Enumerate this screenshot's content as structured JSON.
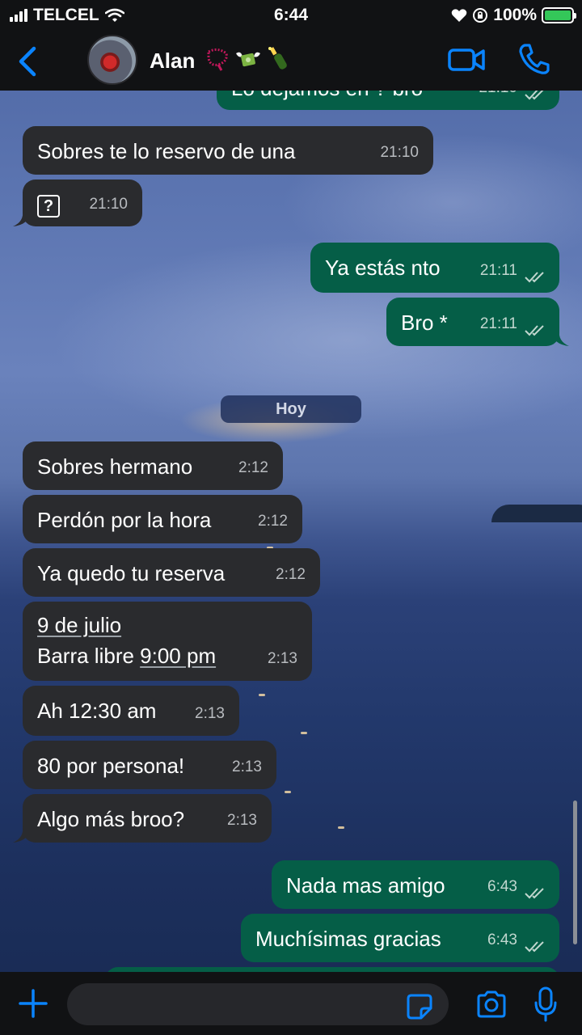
{
  "status_bar": {
    "carrier": "TELCEL",
    "time": "6:44",
    "battery": "100%"
  },
  "header": {
    "contact_name": "Alan"
  },
  "chat": {
    "partial_top_text": "Lo dejamos en ? bro",
    "partial_top_time": "21:10",
    "day_separator": "Hoy",
    "messages": [
      {
        "text": "Sobres te lo reservo de una",
        "time": "21:10"
      },
      {
        "text": "?",
        "time": "21:10"
      },
      {
        "text": "Ya estás nto",
        "time": "21:11"
      },
      {
        "text": "Bro *",
        "time": "21:11"
      },
      {
        "text": "Sobres hermano",
        "time": "2:12"
      },
      {
        "text": "Perdón por la hora",
        "time": "2:12"
      },
      {
        "text": "Ya quedo tu reserva",
        "time": "2:12"
      },
      {
        "line1": "9 de julio",
        "line2_a": "Barra libre ",
        "line2_b": "9:00 pm",
        "time": "2:13"
      },
      {
        "text": "Ah 12:30 am",
        "time": "2:13"
      },
      {
        "text": "80 por persona!",
        "time": "2:13"
      },
      {
        "text": "Algo más broo?",
        "time": "2:13"
      },
      {
        "text": "Nada mas amigo",
        "time": "6:43"
      },
      {
        "text": "Muchísimas gracias",
        "time": "6:43"
      }
    ]
  },
  "input": {
    "placeholder": ""
  },
  "colors": {
    "incoming_bubble": "#2a2b2e",
    "outgoing_bubble": "#055e47",
    "accent": "#0a84ff"
  }
}
